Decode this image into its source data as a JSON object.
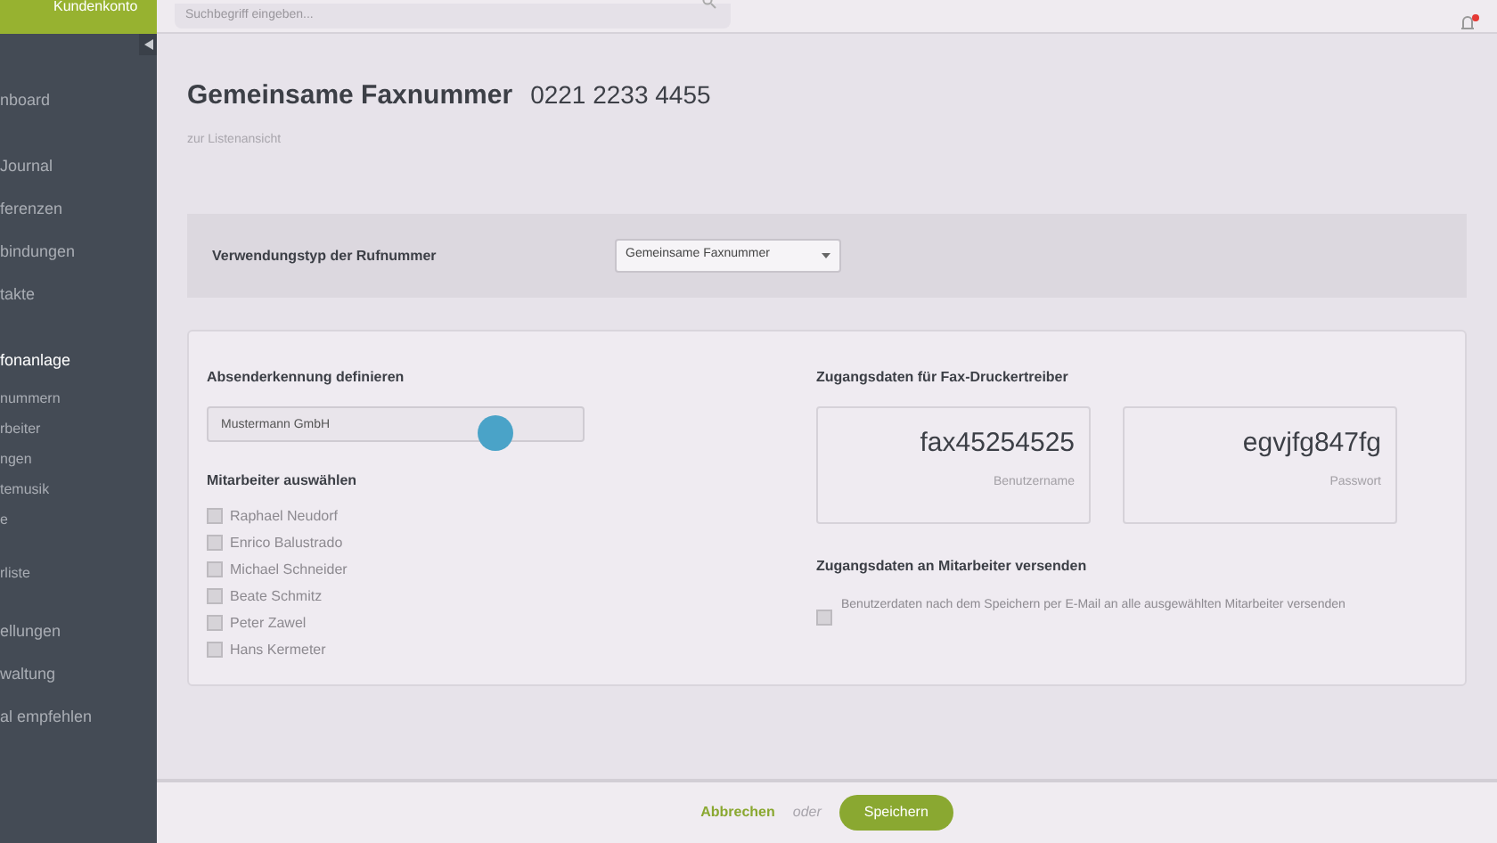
{
  "sidebar": {
    "brand": "Kundenkonto",
    "items": [
      {
        "label": "nboard",
        "kind": "main",
        "selected": false
      },
      {
        "label": "Journal",
        "kind": "main",
        "selected": false
      },
      {
        "label": "ferenzen",
        "kind": "main",
        "selected": false
      },
      {
        "label": "bindungen",
        "kind": "main",
        "selected": false
      },
      {
        "label": "takte",
        "kind": "main",
        "selected": false
      },
      {
        "label": "fonanlage",
        "kind": "main",
        "selected": true,
        "children": [
          {
            "label": "nummern",
            "selected": false
          },
          {
            "label": "rbeiter",
            "selected": false
          },
          {
            "label": "ngen",
            "selected": false
          },
          {
            "label": "temusik",
            "selected": false
          },
          {
            "label": "e",
            "selected": false
          }
        ]
      },
      {
        "label": "rliste",
        "kind": "sub",
        "selected": false
      },
      {
        "label": "ellungen",
        "kind": "main",
        "selected": false
      },
      {
        "label": "waltung",
        "kind": "main",
        "selected": false
      },
      {
        "label": "al empfehlen",
        "kind": "main",
        "selected": false
      }
    ]
  },
  "topbar": {
    "search": {
      "placeholder": "Suchbegriff eingeben..."
    }
  },
  "page": {
    "title": "Gemeinsame Faxnummer",
    "number": "0221 2233 4455",
    "back_link": "zur Listenansicht"
  },
  "usage": {
    "label": "Verwendungstyp der Rufnummer",
    "value": "Gemeinsame Faxnummer"
  },
  "sender": {
    "label": "Absenderkennung definieren",
    "value": "Mustermann GmbH"
  },
  "employees": {
    "label": "Mitarbeiter auswählen",
    "items": [
      {
        "name": "Raphael Neudorf",
        "checked": false
      },
      {
        "name": "Enrico Balustrado",
        "checked": false
      },
      {
        "name": "Michael Schneider",
        "checked": false
      },
      {
        "name": "Beate Schmitz",
        "checked": false
      },
      {
        "name": "Peter Zawel",
        "checked": false
      },
      {
        "name": "Hans Kermeter",
        "checked": false
      }
    ]
  },
  "credentials": {
    "label": "Zugangsdaten für Fax-Druckertreiber",
    "items": [
      {
        "value": "fax45254525",
        "caption": "Benutzername"
      },
      {
        "value": "egvjfg847fg",
        "caption": "Passwort"
      }
    ]
  },
  "send": {
    "label": "Zugangsdaten an Mitarbeiter versenden",
    "option": {
      "text": "Benutzerdaten nach dem Speichern per E-Mail an alle ausgewählten Mitarbeiter versenden",
      "checked": false
    }
  },
  "footer": {
    "cancel": "Abbrechen",
    "or": "oder",
    "save": "Speichern"
  }
}
